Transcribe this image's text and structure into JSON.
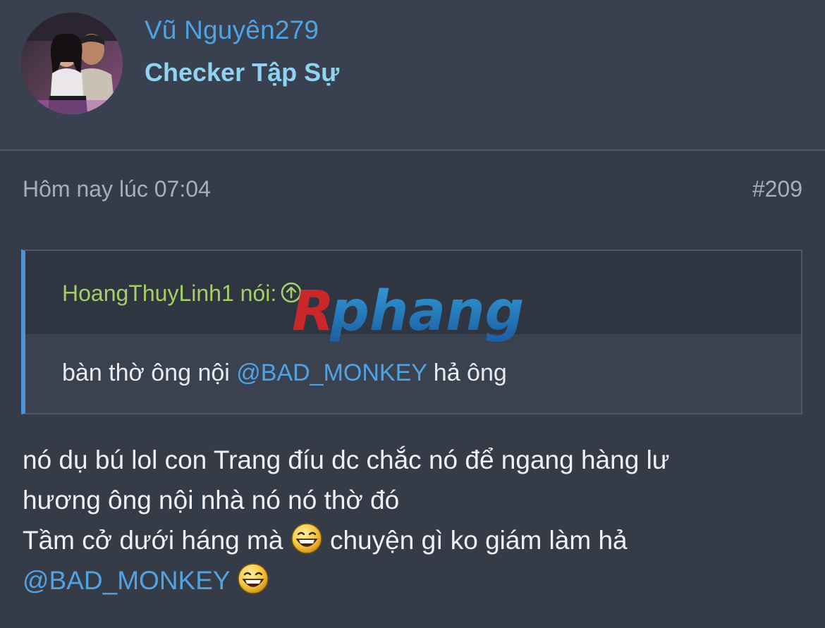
{
  "user": {
    "name": "Vũ Nguyên279",
    "title": "Checker Tập Sự"
  },
  "post": {
    "time": "Hôm nay lúc 07:04",
    "number": "#209"
  },
  "quote": {
    "author_line": "HoangThuyLinh1 nói:",
    "text_before": "bàn thờ ông nội ",
    "mention": "@BAD_MONKEY",
    "text_after": " hả ông"
  },
  "watermark": {
    "text": "Rphang"
  },
  "body": {
    "line1": "nó dụ bú lol con Trang đíu dc chắc nó để ngang hàng lư",
    "line2": "hương ông nội nhà nó nó thờ đó",
    "line3_before": "Tầm cở dưới háng mà ",
    "line3_after": " chuyện gì ko giám làm hả",
    "line4_mention": "@BAD_MONKEY",
    "emoji": "laughing-emoji-icon"
  },
  "colors": {
    "username": "#4fa3e3",
    "user_title": "#8fd3f0",
    "quote_author": "#a4cf67",
    "quote_border": "#4e92d8",
    "mention": "#4fa3e3",
    "background": "#353c48"
  }
}
